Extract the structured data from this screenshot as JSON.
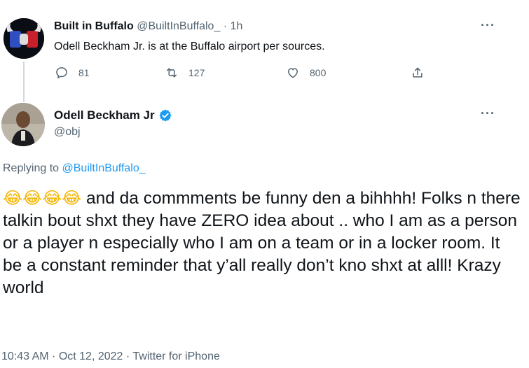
{
  "parent_tweet": {
    "name": "Built in Buffalo",
    "handle": "@BuiltInBuffalo_",
    "time": "· 1h",
    "text": "Odell Beckham Jr. is at the Buffalo airport per sources.",
    "more_icon": "more-horizontal-icon",
    "actions": {
      "reply_count": "81",
      "retweet_count": "127",
      "like_count": "800"
    }
  },
  "main_tweet": {
    "name": "Odell Beckham Jr",
    "handle": "@obj",
    "verified": true,
    "replying_prefix": "Replying to ",
    "replying_to": "@BuiltInBuffalo_",
    "emojis": "😂😂😂😂",
    "text": "and da commments be funny den a bihhhh! Folks n there talkin bout shxt they have ZERO idea about .. who I am as a person or a player n especially who I am on a team or in a locker room. It be a constant reminder that y’all really don’t kno shxt at alll! Krazy world",
    "timestamp": "10:43 AM · Oct 12, 2022 · Twitter for iPhone"
  },
  "colors": {
    "accent": "#1d9bf0",
    "secondary_text": "#536471",
    "primary_text": "#0f1419"
  }
}
